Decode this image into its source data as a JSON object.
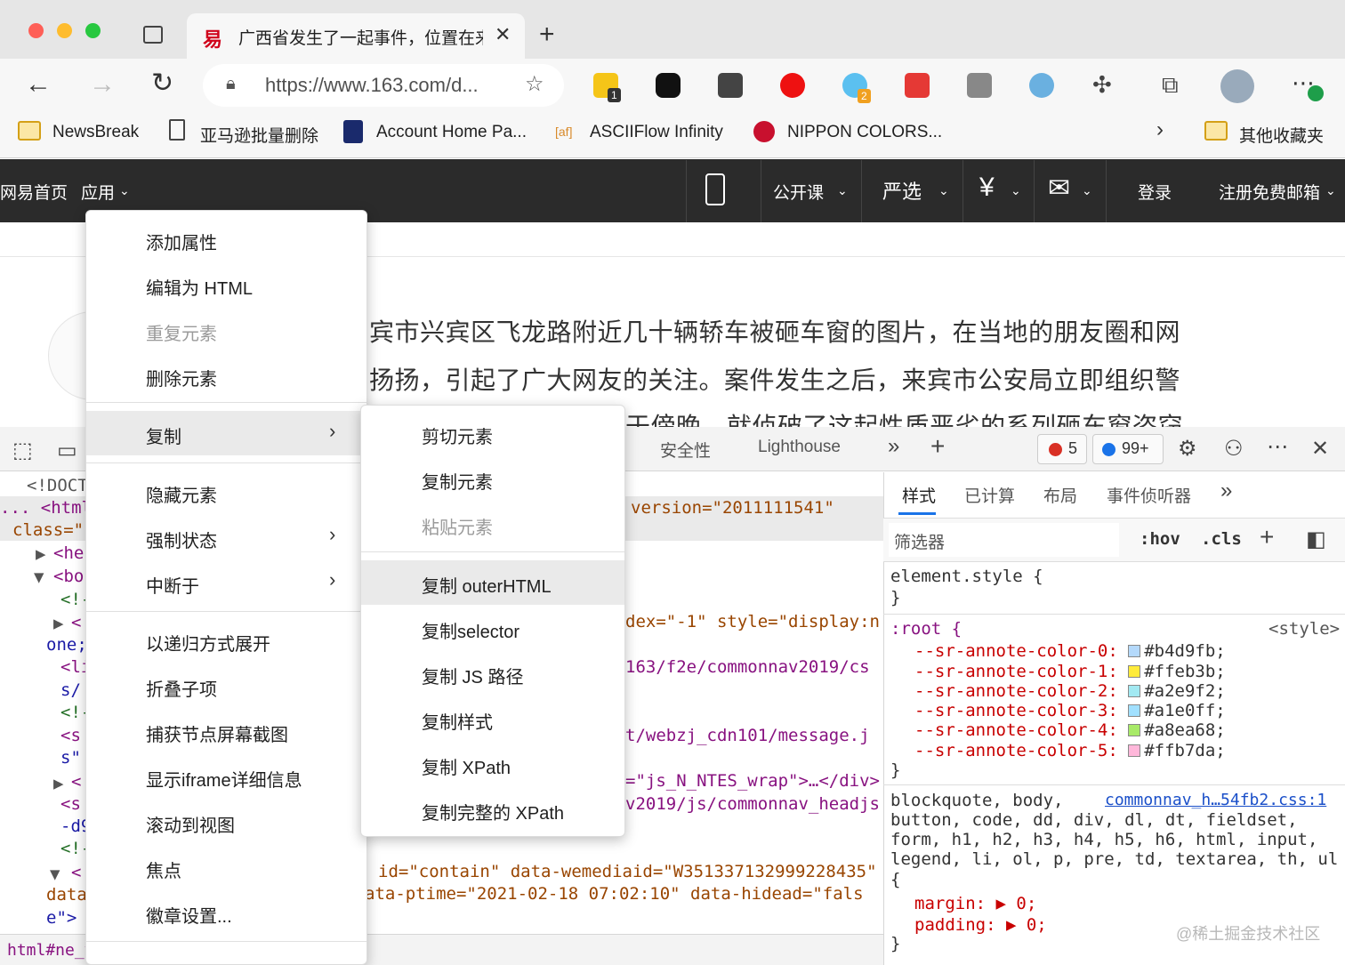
{
  "browser": {
    "tab_title": "广西省发生了一起事件，位置在来",
    "url": "https://www.163.com/d...",
    "extension_badges": [
      "1",
      "2"
    ],
    "bookmarks": [
      "NewsBreak",
      "亚马逊批量删除",
      "Account Home Pa...",
      "ASCIIFlow Infinity",
      "NIPPON COLORS...",
      "其他收藏夹"
    ]
  },
  "site_nav": {
    "home": "网易首页",
    "apps": "应用",
    "open_course": "公开课",
    "yanxuan": "严选",
    "login": "登录",
    "register": "注册免费邮箱"
  },
  "article": {
    "lines": [
      "宾市兴宾区飞龙路附近几十辆轿车被砸车窗的图片，在当地的朋友圈和网",
      "扬扬，引起了广大网友的关注。案件发生之后，来宾市公安局立即组织警",
      "于傍晚，就侦破了这起性质恶劣的系列砸车窗盗窃"
    ]
  },
  "devtools": {
    "tabs": [
      "安全性",
      "Lighthouse"
    ],
    "error_count": "5",
    "message_count": "99+",
    "elements": {
      "left_fragments": [
        "<!DOCT",
        "... <html",
        "class=\"",
        "<he",
        "<bo",
        "<!-",
        "<",
        "one;",
        "<li",
        "s/",
        "<!-",
        "<s",
        "s\"",
        "<",
        "<s",
        "-d9",
        "<!-",
        "<",
        "data",
        "e\">"
      ],
      "right_fragments": [
        "version=\"2011111541\"",
        "dex=\"-1\" style=\"display:n",
        "163/f2e/commonnav2019/cs",
        "t/webzj_cdn101/message.j",
        "=\"js_N_NTES_wrap\">…</div>",
        "v2019/js/commonnav_headjs",
        "id=\"contain\" data-wemediaid=\"W351337132999228435\"",
        "ata-ptime=\"2021-02-18 07:02:10\" data-hidead=\"fals"
      ],
      "breadcrumb": "html#ne_v"
    },
    "styles": {
      "tabs": [
        "样式",
        "已计算",
        "布局",
        "事件侦听器"
      ],
      "filter_placeholder": "筛选器",
      "hov": ":hov",
      "cls": ".cls",
      "element_style": "element.style {",
      "close_brace": "}",
      "root_selector": ":root {",
      "root_source": "<style>",
      "vars": [
        {
          "name": "--sr-annote-color-0:",
          "value": "#b4d9fb;",
          "color": "#b4d9fb"
        },
        {
          "name": "--sr-annote-color-1:",
          "value": "#ffeb3b;",
          "color": "#ffeb3b"
        },
        {
          "name": "--sr-annote-color-2:",
          "value": "#a2e9f2;",
          "color": "#a2e9f2"
        },
        {
          "name": "--sr-annote-color-3:",
          "value": "#a1e0ff;",
          "color": "#a1e0ff"
        },
        {
          "name": "--sr-annote-color-4:",
          "value": "#a8ea68;",
          "color": "#a8ea68"
        },
        {
          "name": "--sr-annote-color-5:",
          "value": "#ffb7da;",
          "color": "#ffb7da"
        }
      ],
      "rule2_selectors": [
        "blockquote, body,",
        "button, code, dd, div, dl, dt, fieldset,",
        "form, h1, h2, h3, h4, h5, h6, html, input,",
        "legend, li, ol, p, pre, td, textarea, th, ul",
        "{"
      ],
      "rule2_source": "commonnav_h…54fb2.css:1",
      "margin": "margin: ▶ 0;",
      "padding": "padding: ▶ 0;"
    }
  },
  "context_menu": {
    "items": [
      "添加属性",
      "编辑为 HTML",
      "重复元素",
      "删除元素",
      "复制",
      "隐藏元素",
      "强制状态",
      "中断于",
      "以递归方式展开",
      "折叠子项",
      "捕获节点屏幕截图",
      "显示iframe详细信息",
      "滚动到视图",
      "焦点",
      "徽章设置..."
    ],
    "submenu": [
      "剪切元素",
      "复制元素",
      "粘贴元素",
      "复制 outerHTML",
      "复制selector",
      "复制 JS 路径",
      "复制样式",
      "复制 XPath",
      "复制完整的 XPath"
    ]
  },
  "watermark": "@稀土掘金技术社区"
}
